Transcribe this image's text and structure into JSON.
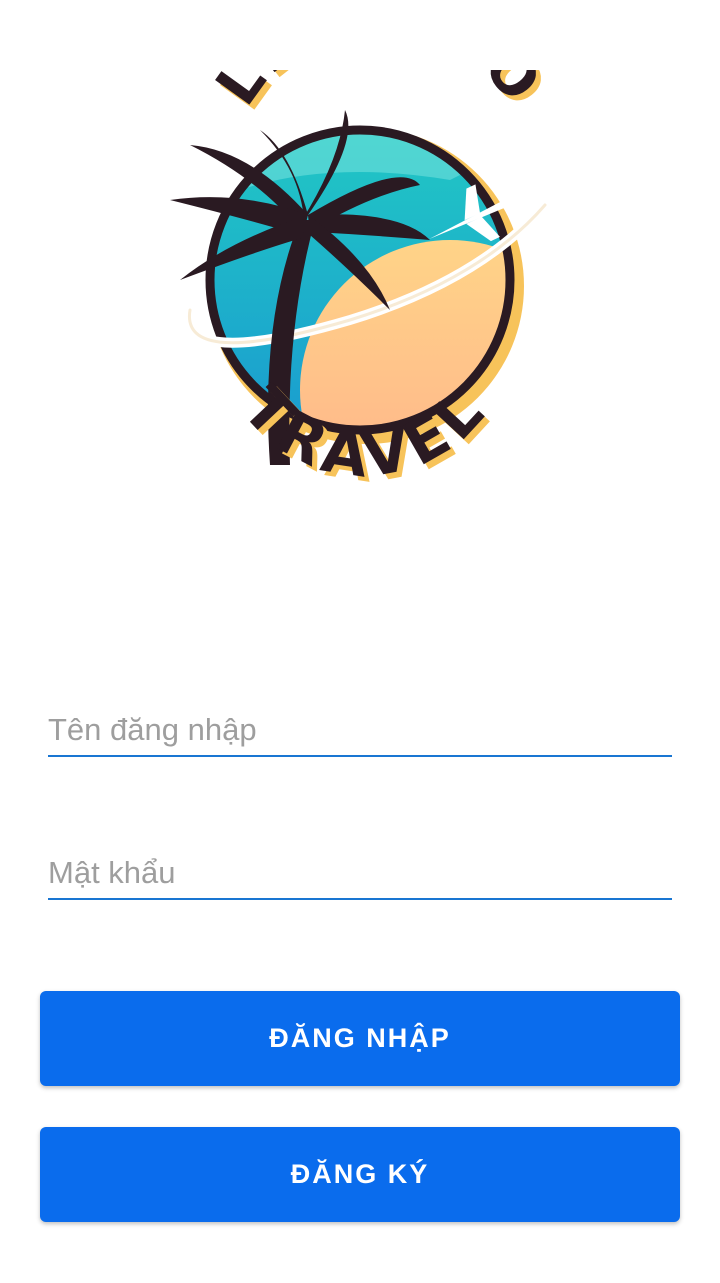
{
  "logo": {
    "line1": "LET'S GO",
    "line2": "TRAVEL",
    "colors": {
      "ink": "#2a1a22",
      "sea": "#1fbfc4",
      "sand": "#ffc98a",
      "shadow": "#f7c35a"
    }
  },
  "form": {
    "username": {
      "placeholder": "Tên đăng nhập",
      "value": ""
    },
    "password": {
      "placeholder": "Mật khẩu",
      "value": ""
    }
  },
  "buttons": {
    "login_label": "ĐĂNG NHẬP",
    "register_label": "ĐĂNG KÝ"
  },
  "theme": {
    "primary": "#0a6ced",
    "underline": "#1976d2"
  }
}
